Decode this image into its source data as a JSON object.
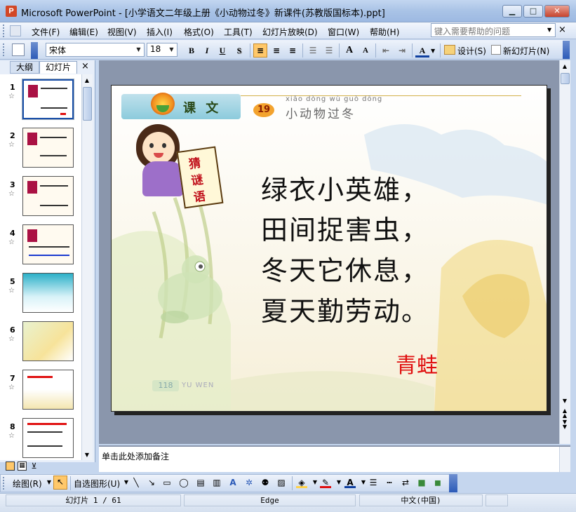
{
  "window": {
    "app_icon": "P",
    "title": "Microsoft PowerPoint - [小学语文二年级上册《小动物过冬》新课件(苏教版国标本).ppt]",
    "controls": [
      "minimize-icon",
      "maximize-icon",
      "close-icon"
    ]
  },
  "menu": {
    "items": [
      "文件(F)",
      "编辑(E)",
      "视图(V)",
      "插入(I)",
      "格式(O)",
      "工具(T)",
      "幻灯片放映(D)",
      "窗口(W)",
      "帮助(H)"
    ],
    "help_placeholder": "键入需要帮助的问题",
    "close": "×"
  },
  "format_toolbar": {
    "font": "宋体",
    "size": "18",
    "bold": "B",
    "italic": "I",
    "underline": "U",
    "shadow": "S",
    "design_label": "设计(S)",
    "new_slide_label": "新幻灯片(N)",
    "grow_font": "A",
    "shrink_font": "A",
    "font_color": "A"
  },
  "left_pane": {
    "tab_outline": "大纲",
    "tab_slides": "幻灯片",
    "close": "×",
    "slides": [
      {
        "num": "1",
        "star": "☆"
      },
      {
        "num": "2",
        "star": "☆"
      },
      {
        "num": "3",
        "star": "☆"
      },
      {
        "num": "4",
        "star": "☆"
      },
      {
        "num": "5",
        "star": "☆"
      },
      {
        "num": "6",
        "star": "☆"
      },
      {
        "num": "7",
        "star": "☆"
      },
      {
        "num": "8",
        "star": "☆"
      }
    ]
  },
  "slide": {
    "banner_label": "课 文",
    "lesson_number": "19",
    "pinyin": "xiǎo dòng wù guò dōng",
    "lesson_title": "小动物过冬",
    "sign_text": [
      "猜",
      "谜",
      "语"
    ],
    "poem": [
      "绿衣小英雄，",
      "田间捉害虫，",
      "冬天它休息，",
      "夏天勤劳动。"
    ],
    "answer": "青蛙",
    "page_number": "118",
    "footer": "YU WEN"
  },
  "notes": {
    "placeholder": "单击此处添加备注"
  },
  "draw_toolbar": {
    "draw_label": "绘图(R)",
    "autoshapes_label": "自选图形(U)"
  },
  "status": {
    "slide_info": "幻灯片 1 / 61",
    "design": "Edge",
    "language": "中文(中国)"
  },
  "colors": {
    "accent_red": "#e01010",
    "title_bar": "#a9c3e6",
    "slide_bg": "#8a96ac"
  }
}
